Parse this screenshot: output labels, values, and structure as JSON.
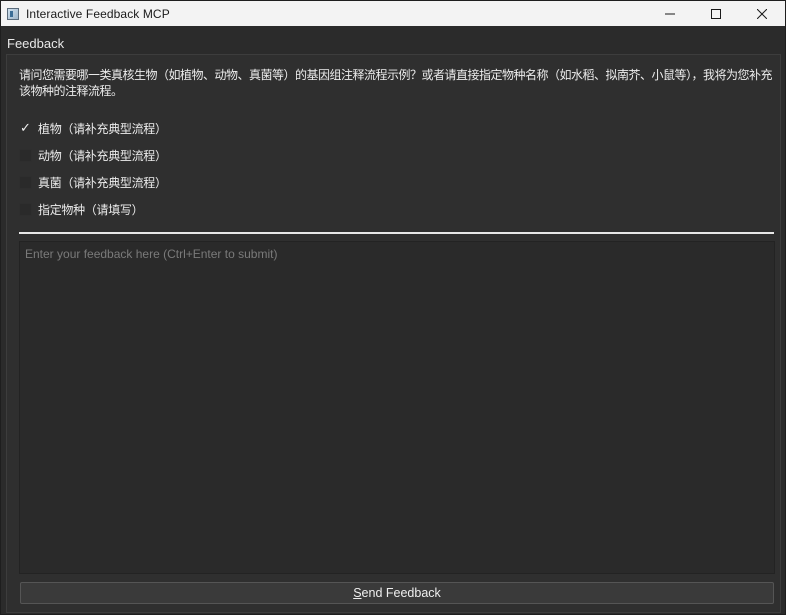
{
  "window": {
    "title": "Interactive Feedback MCP",
    "controls": {
      "minimize_icon": "minimize-icon",
      "maximize_icon": "maximize-icon",
      "close_icon": "close-icon"
    }
  },
  "group": {
    "label": "Feedback"
  },
  "prompt": {
    "text": "请问您需要哪一类真核生物（如植物、动物、真菌等）的基因组注释流程示例？或者请直接指定物种名称（如水稻、拟南芥、小鼠等），我将为您补充该物种的注释流程。"
  },
  "options": [
    {
      "label": "植物（请补充典型流程）",
      "checked": true
    },
    {
      "label": "动物（请补充典型流程）",
      "checked": false
    },
    {
      "label": "真菌（请补充典型流程）",
      "checked": false
    },
    {
      "label": "指定物种（请填写）",
      "checked": false
    }
  ],
  "feedback": {
    "value": "",
    "placeholder": "Enter your feedback here (Ctrl+Enter to submit)"
  },
  "send_button": {
    "mnemonic": "S",
    "rest": "end Feedback"
  },
  "colors": {
    "background": "#2b2b2b",
    "titlebar": "#f3f3f3",
    "text": "#ececec",
    "placeholder": "#7a7a7a"
  }
}
